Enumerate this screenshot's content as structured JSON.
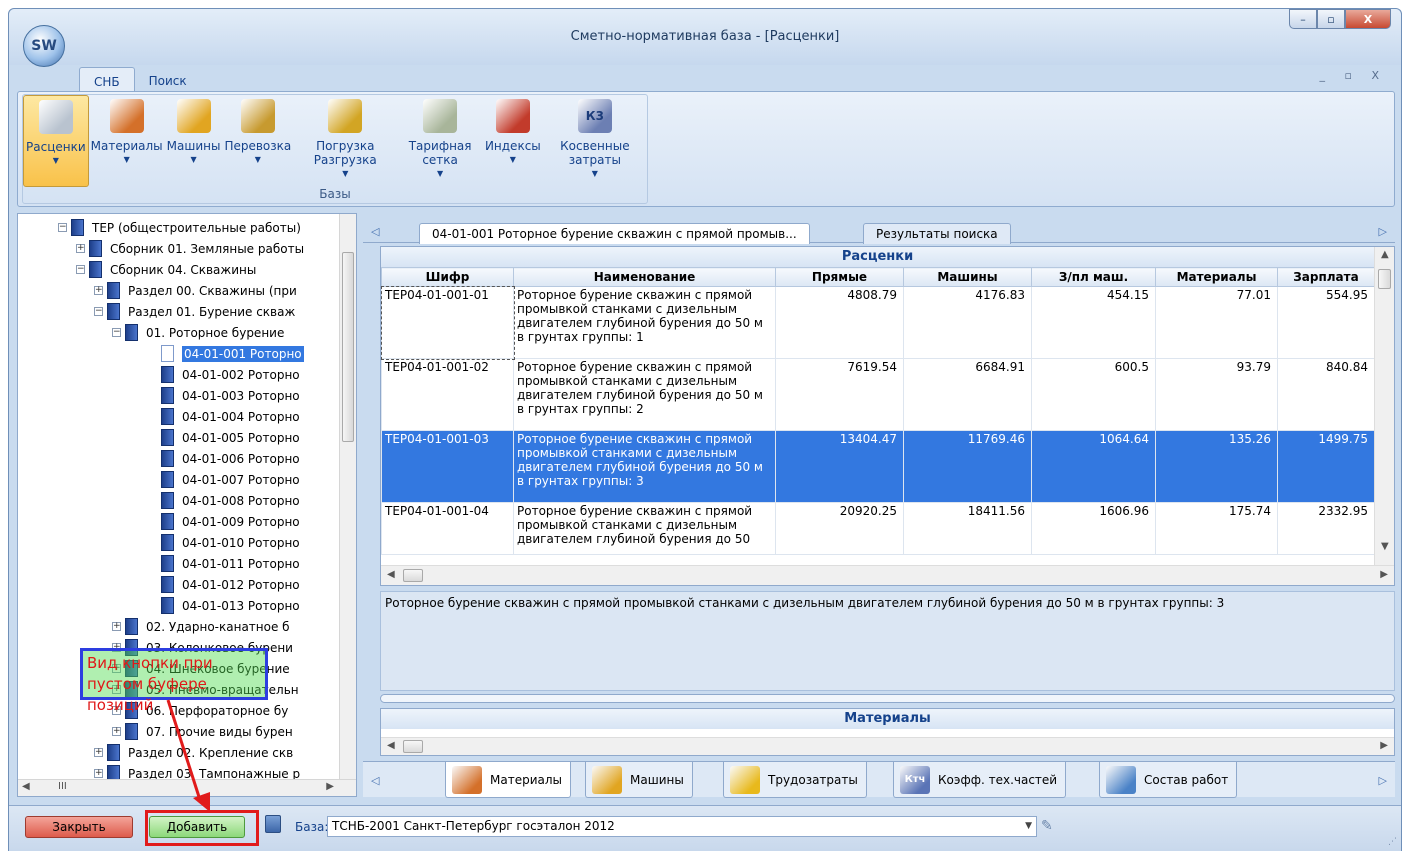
{
  "window": {
    "title": "Сметно-нормативная база - [Расценки]",
    "app_logo": "SW",
    "controls": {
      "minimize": "–",
      "maximize": "▫",
      "close": "X"
    },
    "mdi_controls": "_ ▫ X"
  },
  "ribbon": {
    "tabs": [
      {
        "label": "СНБ"
      },
      {
        "label": "Поиск"
      }
    ],
    "group_label": "Базы",
    "items": [
      {
        "label": "Расценки",
        "icon": "database-icon",
        "color": "#b9c3cf"
      },
      {
        "label": "Материалы",
        "icon": "bricks-icon",
        "color": "#d4702a"
      },
      {
        "label": "Машины",
        "icon": "bulldozer-icon",
        "color": "#e1a521"
      },
      {
        "label": "Перевозка",
        "icon": "dump-truck-icon",
        "color": "#c79a2f"
      },
      {
        "label": "Погрузка Разгрузка",
        "icon": "forklift-icon",
        "color": "#d2a524"
      },
      {
        "label": "Тарифная сетка",
        "icon": "money-stack-icon",
        "color": "#a8b59a"
      },
      {
        "label": "Индексы",
        "icon": "chart-icon",
        "color": "#c23b2b"
      },
      {
        "label": "Косвенные затраты",
        "icon": "k3-icon",
        "color": "#6c7fb3",
        "badge": "К3"
      }
    ]
  },
  "tree": {
    "items": [
      {
        "label": "ТЕР (общестроительные работы)",
        "expander": "−"
      },
      {
        "label": "Сборник 01. Земляные работы",
        "expander": "+"
      },
      {
        "label": "Сборник 04. Скважины",
        "expander": "−"
      },
      {
        "label": "Раздел 00. Скважины (при",
        "expander": "+"
      },
      {
        "label": "Раздел 01. Бурение скваж",
        "expander": "−"
      },
      {
        "label": "01. Роторное бурение",
        "expander": "−"
      },
      {
        "label": "04-01-001 Роторно",
        "expander": "",
        "selected": true
      },
      {
        "label": "04-01-002 Роторно",
        "expander": ""
      },
      {
        "label": "04-01-003 Роторно",
        "expander": ""
      },
      {
        "label": "04-01-004 Роторно",
        "expander": ""
      },
      {
        "label": "04-01-005 Роторно",
        "expander": ""
      },
      {
        "label": "04-01-006 Роторно",
        "expander": ""
      },
      {
        "label": "04-01-007 Роторно",
        "expander": ""
      },
      {
        "label": "04-01-008 Роторно",
        "expander": ""
      },
      {
        "label": "04-01-009 Роторно",
        "expander": ""
      },
      {
        "label": "04-01-010 Роторно",
        "expander": ""
      },
      {
        "label": "04-01-011 Роторно",
        "expander": ""
      },
      {
        "label": "04-01-012 Роторно",
        "expander": ""
      },
      {
        "label": "04-01-013 Роторно",
        "expander": ""
      },
      {
        "label": "02. Ударно-канатное б",
        "expander": "+"
      },
      {
        "label": "03. Колонковое бурени",
        "expander": "+"
      },
      {
        "label": "04. Шнековое бурение",
        "expander": "+"
      },
      {
        "label": "05. Пневмо-вращательн",
        "expander": "+"
      },
      {
        "label": "06. Перфораторное бу",
        "expander": "+"
      },
      {
        "label": "07. Прочие виды бурен",
        "expander": "+"
      },
      {
        "label": "Раздел 02. Крепление скв",
        "expander": "+"
      },
      {
        "label": "Раздел 03. Тампонажные р",
        "expander": "+"
      }
    ],
    "hscroll_thumb": "III"
  },
  "doc_tabs": [
    {
      "label": "04-01-001 Роторное бурение скважин с прямой промыв..."
    },
    {
      "label": "Результаты поиска"
    }
  ],
  "grid": {
    "caption": "Расценки",
    "columns": [
      "Шифр",
      "Наименование",
      "Прямые",
      "Машины",
      "З/пл маш.",
      "Материалы",
      "Зарплата"
    ],
    "rows": [
      {
        "code": "ТЕР04-01-001-01",
        "name": "Роторное бурение скважин с прямой промывкой станками с дизельным двигателем глубиной бурения до 50 м в грунтах группы: 1",
        "direct": "4808.79",
        "machines": "4176.83",
        "mach_wage": "454.15",
        "materials": "77.01",
        "wage": "554.95"
      },
      {
        "code": "ТЕР04-01-001-02",
        "name": "Роторное бурение скважин с прямой промывкой станками с дизельным двигателем глубиной бурения до 50 м в грунтах группы: 2",
        "direct": "7619.54",
        "machines": "6684.91",
        "mach_wage": "600.5",
        "materials": "93.79",
        "wage": "840.84"
      },
      {
        "code": "ТЕР04-01-001-03",
        "name": "Роторное бурение скважин с прямой промывкой станками с дизельным двигателем глубиной бурения до 50 м в грунтах группы: 3",
        "direct": "13404.47",
        "machines": "11769.46",
        "mach_wage": "1064.64",
        "materials": "135.26",
        "wage": "1499.75",
        "selected": true
      },
      {
        "code": "ТЕР04-01-001-04",
        "name": "Роторное бурение скважин с прямой промывкой станками с дизельным двигателем глубиной бурения до 50",
        "direct": "20920.25",
        "machines": "18411.56",
        "mach_wage": "1606.96",
        "materials": "175.74",
        "wage": "2332.95"
      }
    ]
  },
  "description": "Роторное бурение скважин с прямой промывкой станками с дизельным двигателем глубиной бурения до 50 м в грунтах группы: 3",
  "sub_grid": {
    "caption": "Материалы"
  },
  "bottom_tabs": [
    {
      "label": "Материалы",
      "icon": "materials-eye-icon",
      "color": "#d4702a"
    },
    {
      "label": "Машины",
      "icon": "machines-eye-icon",
      "color": "#e1a521"
    },
    {
      "label": "Трудозатраты",
      "icon": "hardhat-eye-icon",
      "color": "#e8b91c"
    },
    {
      "label": "Коэфф. тех.частей",
      "icon": "coefficient-eye-icon",
      "color": "#5a74b6",
      "badge": "Ктч"
    },
    {
      "label": "Состав работ",
      "icon": "tools-eye-icon",
      "color": "#4a82c7"
    }
  ],
  "statusbar": {
    "close_label": "Закрыть",
    "add_label": "Добавить",
    "base_label": "База:",
    "base_value": "ТСНБ-2001 Санкт-Петербург госэталон 2012"
  },
  "annotation": {
    "text": "Вид кнопки при пустом буфере позиций",
    "color_text": "#e01818",
    "color_border": "#2d3ee0",
    "color_arrow": "#e11b1b"
  }
}
